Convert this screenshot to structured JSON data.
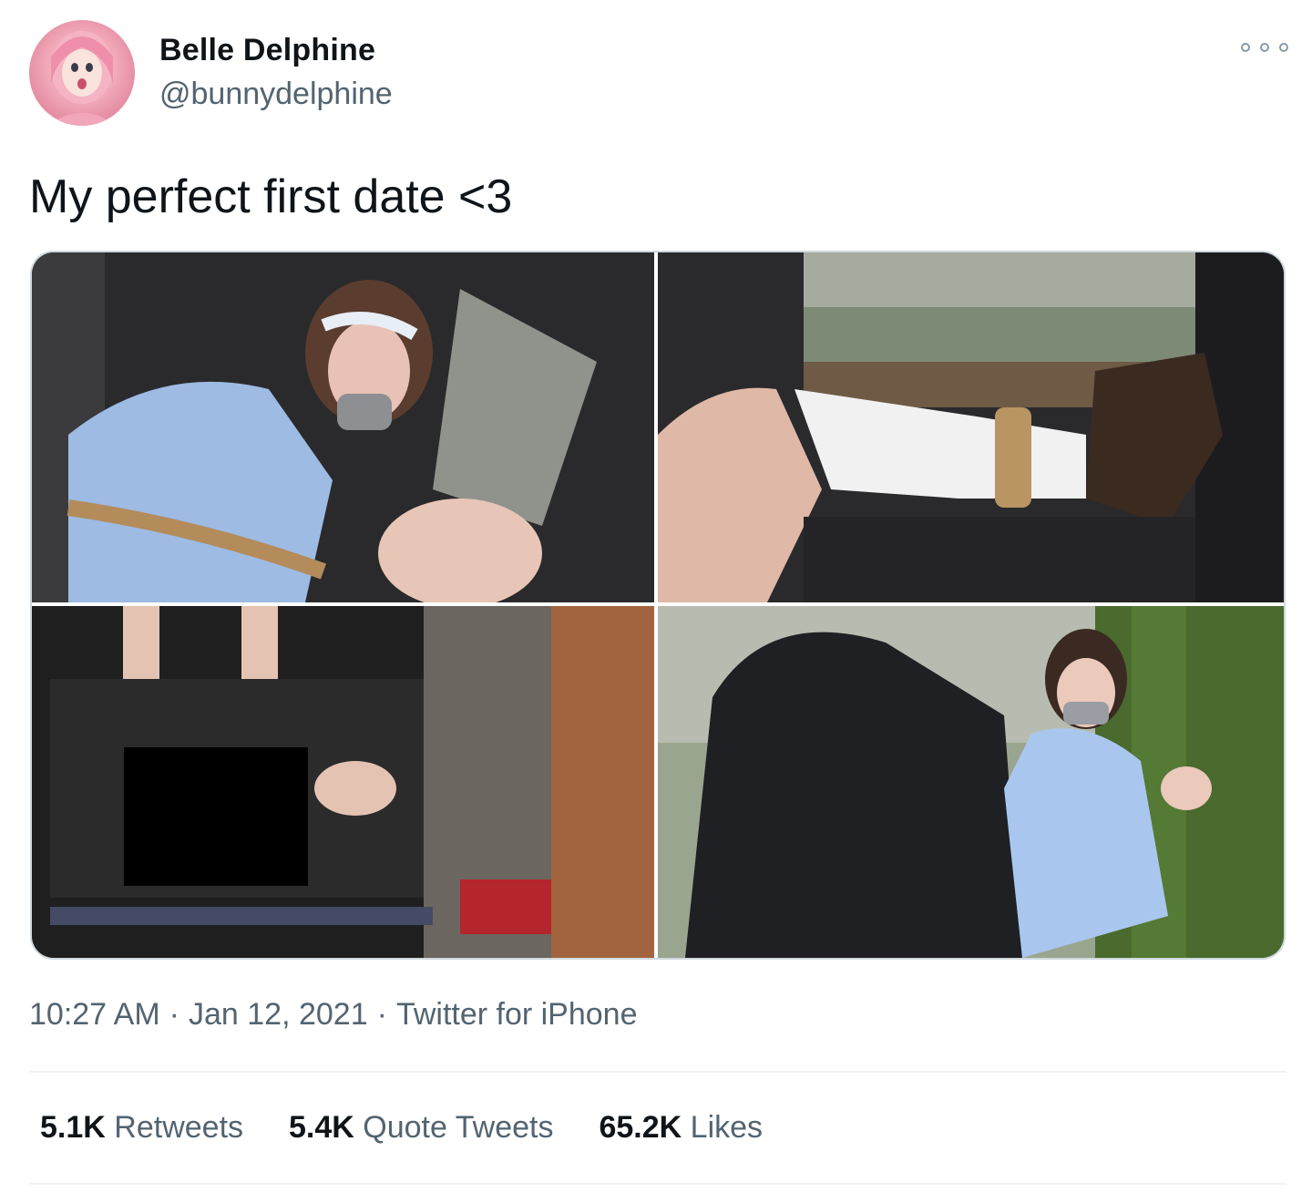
{
  "author": {
    "display_name": "Belle Delphine",
    "handle": "@bunnydelphine",
    "avatar_icon": "profile-avatar"
  },
  "more_icon": "more-options-icon",
  "tweet": {
    "text": "My perfect first date <3"
  },
  "media": {
    "count": 4,
    "photos": [
      {
        "name": "photo-1",
        "description_icon": "image"
      },
      {
        "name": "photo-2",
        "description_icon": "image"
      },
      {
        "name": "photo-3",
        "description_icon": "image"
      },
      {
        "name": "photo-4",
        "description_icon": "image"
      }
    ]
  },
  "meta": {
    "time": "10:27 AM",
    "separator": "·",
    "date": "Jan 12, 2021",
    "source": "Twitter for iPhone"
  },
  "stats": {
    "retweets_count": "5.1K",
    "retweets_label": "Retweets",
    "quotes_count": "5.4K",
    "quotes_label": "Quote Tweets",
    "likes_count": "65.2K",
    "likes_label": "Likes"
  },
  "colors": {
    "text_primary": "#0f1419",
    "text_secondary": "#536471",
    "border": "#cfd9de",
    "divider": "#eff3f4"
  }
}
